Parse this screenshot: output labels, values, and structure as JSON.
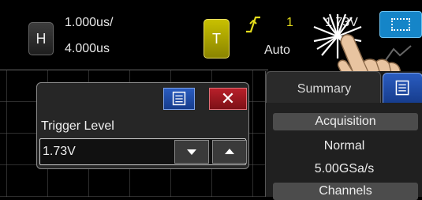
{
  "topbar": {
    "h_button_label": "H",
    "timebase": "1.000us/",
    "delay": "4.000us",
    "t_button_label": "T",
    "trigger_channel": "1",
    "trigger_mode": "Auto",
    "trigger_level_partial": "1.73V"
  },
  "dialog": {
    "title": "Trigger Level",
    "value": "1.73V",
    "close_label": "✕"
  },
  "side_panel": {
    "tab_label": "Summary",
    "sections": [
      {
        "header": "Acquisition",
        "values": [
          "Normal",
          "5.00GSa/s"
        ]
      },
      {
        "header": "Channels",
        "values": []
      }
    ]
  },
  "colors": {
    "trigger_yellow": "#e4dc1c",
    "menu_blue": "#1f4aa8",
    "close_red": "#a8141e",
    "select_blue": "#1585c8"
  },
  "icons": [
    "menu-icon",
    "close-icon",
    "chevron-down-icon",
    "chevron-up-icon",
    "select-box-icon",
    "touch-icon",
    "rising-edge-icon",
    "hand-pointer-icon"
  ]
}
